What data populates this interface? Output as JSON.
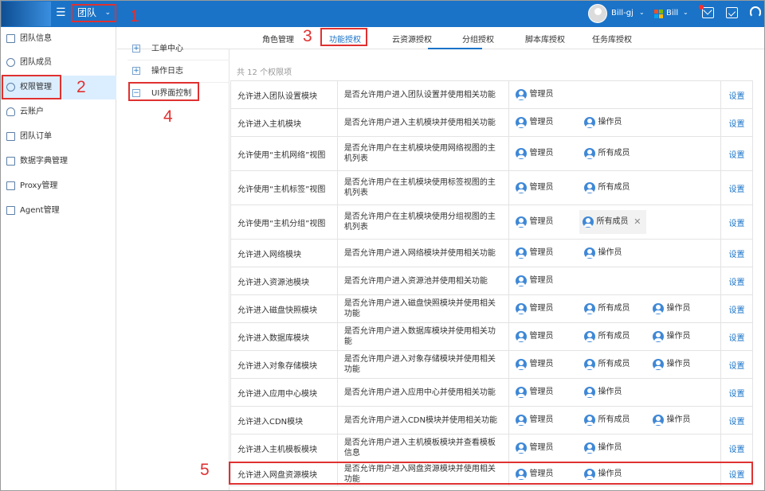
{
  "topbar": {
    "team_selector": "团队",
    "username": "Bill-gj",
    "org_name": "Bill",
    "colors": {
      "bar": "#1a73c7",
      "highlight": "#e03131"
    }
  },
  "sidebar": {
    "items": [
      {
        "label": "团队信息",
        "icon": "info-icon"
      },
      {
        "label": "团队成员",
        "icon": "people-icon"
      },
      {
        "label": "权限管理",
        "icon": "user-gear-icon"
      },
      {
        "label": "云账户",
        "icon": "cloud-icon"
      },
      {
        "label": "团队订单",
        "icon": "order-icon"
      },
      {
        "label": "数据字典管理",
        "icon": "book-icon"
      },
      {
        "label": "Proxy管理",
        "icon": "proxy-icon"
      },
      {
        "label": "Agent管理",
        "icon": "agent-icon"
      }
    ]
  },
  "tabs": [
    "角色管理",
    "功能授权",
    "云资源授权",
    "分组授权",
    "脚本库授权",
    "任务库授权"
  ],
  "tree": {
    "items": [
      {
        "label": "工单中心",
        "expander": "+"
      },
      {
        "label": "操作日志",
        "expander": "+"
      },
      {
        "label": "UI界面控制",
        "expander": "−"
      }
    ]
  },
  "content": {
    "count_text": "共 12 个权限项",
    "setting_label": "设置",
    "rows": [
      {
        "name": "允许进入团队设置模块",
        "desc": "是否允许用户进入团队设置并使用相关功能",
        "roles": [
          "管理员"
        ]
      },
      {
        "name": "允许进入主机模块",
        "desc": "是否允许用户进入主机模块并使用相关功能",
        "roles": [
          "管理员",
          "操作员"
        ]
      },
      {
        "name": "允许使用“主机网络”视图",
        "desc": "是否允许用户在主机模块使用网络视图的主机列表",
        "roles": [
          "管理员",
          "所有成员"
        ]
      },
      {
        "name": "允许使用“主机标签”视图",
        "desc": "是否允许用户在主机模块使用标签视图的主机列表",
        "roles": [
          "管理员",
          "所有成员"
        ]
      },
      {
        "name": "允许使用“主机分组”视图",
        "desc": "是否允许用户在主机模块使用分组视图的主机列表",
        "roles": [
          "管理员",
          "所有成员"
        ]
      },
      {
        "name": "允许进入网络模块",
        "desc": "是否允许用户进入网络模块并使用相关功能",
        "roles": [
          "管理员",
          "操作员"
        ]
      },
      {
        "name": "允许进入资源池模块",
        "desc": "是否允许用户进入资源池并使用相关功能",
        "roles": [
          "管理员"
        ]
      },
      {
        "name": "允许进入磁盘快照模块",
        "desc": "是否允许用户进入磁盘快照模块并使用相关功能",
        "roles": [
          "管理员",
          "所有成员",
          "操作员"
        ]
      },
      {
        "name": "允许进入数据库模块",
        "desc": "是否允许用户进入数据库模块并使用相关功能",
        "roles": [
          "管理员",
          "所有成员",
          "操作员"
        ]
      },
      {
        "name": "允许进入对象存储模块",
        "desc": "是否允许用户进入对象存储模块并使用相关功能",
        "roles": [
          "管理员",
          "所有成员",
          "操作员"
        ]
      },
      {
        "name": "允许进入应用中心模块",
        "desc": "是否允许用户进入应用中心并使用相关功能",
        "roles": [
          "管理员",
          "操作员"
        ]
      },
      {
        "name": "允许进入CDN模块",
        "desc": "是否允许用户进入CDN模块并使用相关功能",
        "roles": [
          "管理员",
          "所有成员",
          "操作员"
        ]
      },
      {
        "name": "允许进入主机模板模块",
        "desc": "是否允许用户进入主机模板模块并查看模板信息",
        "roles": [
          "管理员",
          "操作员"
        ]
      },
      {
        "name": "允许进入网盘资源模块",
        "desc": "是否允许用户进入网盘资源模块并使用相关功能",
        "roles": [
          "管理员",
          "操作员"
        ]
      }
    ]
  },
  "callouts": [
    "1",
    "2",
    "3",
    "4",
    "5"
  ]
}
